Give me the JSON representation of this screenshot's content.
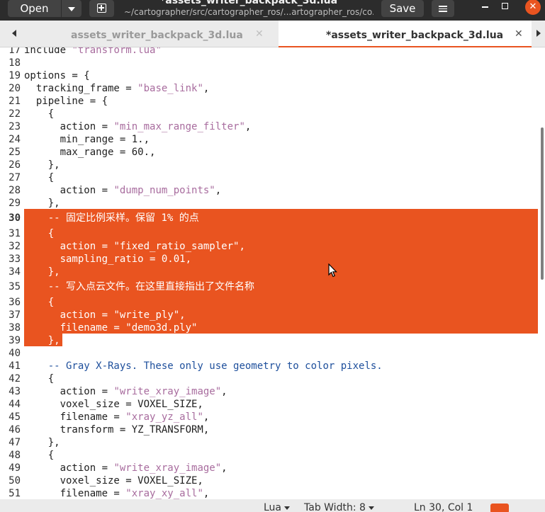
{
  "header": {
    "open_label": "Open",
    "save_label": "Save",
    "title": "*assets_writer_backpack_3d.lua",
    "subtitle": "~/cartographer/src/cartographer_ros/...artographer_ros/co..."
  },
  "tabs": [
    {
      "label": "assets_writer_backpack_3d.lua",
      "active": false
    },
    {
      "label": "*assets_writer_backpack_3d.lua",
      "active": true
    }
  ],
  "editor": {
    "current_line": 30,
    "lines": [
      {
        "n": "17",
        "text": "include \"transform.lua\""
      },
      {
        "n": "18",
        "text": ""
      },
      {
        "n": "19",
        "text": "options = {"
      },
      {
        "n": "20",
        "text": "  tracking_frame = \"base_link\","
      },
      {
        "n": "21",
        "text": "  pipeline = {"
      },
      {
        "n": "22",
        "text": "    {"
      },
      {
        "n": "23",
        "text": "      action = \"min_max_range_filter\","
      },
      {
        "n": "24",
        "text": "      min_range = 1.,"
      },
      {
        "n": "25",
        "text": "      max_range = 60.,"
      },
      {
        "n": "26",
        "text": "    },"
      },
      {
        "n": "27",
        "text": "    {"
      },
      {
        "n": "28",
        "text": "      action = \"dump_num_points\","
      },
      {
        "n": "29",
        "text": "    },"
      },
      {
        "n": "30",
        "text": "    -- 固定比例采样。保留 1% 的点"
      },
      {
        "n": "31",
        "text": "    {"
      },
      {
        "n": "32",
        "text": "      action = \"fixed_ratio_sampler\","
      },
      {
        "n": "33",
        "text": "      sampling_ratio = 0.01,"
      },
      {
        "n": "34",
        "text": "    },"
      },
      {
        "n": "35",
        "text": "    -- 写入点云文件。在这里直接指出了文件名称"
      },
      {
        "n": "36",
        "text": "    {"
      },
      {
        "n": "37",
        "text": "      action = \"write_ply\","
      },
      {
        "n": "38",
        "text": "      filename = \"demo3d.ply\""
      },
      {
        "n": "39",
        "text": "    },"
      },
      {
        "n": "40",
        "text": ""
      },
      {
        "n": "41",
        "text": "    -- Gray X-Rays. These only use geometry to color pixels."
      },
      {
        "n": "42",
        "text": "    {"
      },
      {
        "n": "43",
        "text": "      action = \"write_xray_image\","
      },
      {
        "n": "44",
        "text": "      voxel_size = VOXEL_SIZE,"
      },
      {
        "n": "45",
        "text": "      filename = \"xray_yz_all\","
      },
      {
        "n": "46",
        "text": "      transform = YZ_TRANSFORM,"
      },
      {
        "n": "47",
        "text": "    },"
      },
      {
        "n": "48",
        "text": "    {"
      },
      {
        "n": "49",
        "text": "      action = \"write_xray_image\","
      },
      {
        "n": "50",
        "text": "      voxel_size = VOXEL_SIZE,"
      },
      {
        "n": "51",
        "text": "      filename = \"xray_xy_all\","
      }
    ]
  },
  "statusbar": {
    "language": "Lua",
    "tab_width": "Tab Width: 8",
    "position": "Ln 30, Col 1"
  },
  "colors": {
    "accent": "#e95420",
    "header_bg": "#2c2c2c",
    "string": "#a86c9e",
    "comment": "#1e4f9c"
  }
}
